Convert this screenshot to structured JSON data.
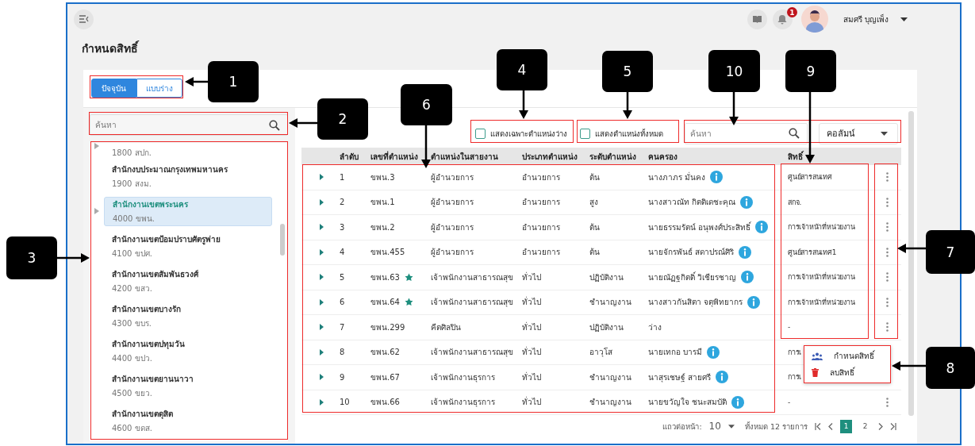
{
  "header": {
    "user_name": "สมศรี บุญเพ็ง",
    "notification_count": "1"
  },
  "page_title": "กำหนดสิทธิ์",
  "version_tabs": [
    {
      "label": "ปัจจุบัน",
      "selected": true
    },
    {
      "label": "แบบร่าง",
      "selected": false
    }
  ],
  "org_search": {
    "placeholder": "ค้นหา"
  },
  "org_list": [
    {
      "code": "1800 สปก.",
      "has_children": true,
      "selected": false
    },
    {
      "name": "สำนักงบประมาณกรุงเทพมหานคร",
      "code": "1900 สงม.",
      "has_children": false,
      "selected": false
    },
    {
      "name": "สำนักงานเขตพระนคร",
      "code": "4000 ขพน.",
      "has_children": true,
      "selected": true
    },
    {
      "name": "สำนักงานเขตป้อมปราบศัตรูพ่าย",
      "code": "4100 ขปศ.",
      "has_children": false,
      "selected": false
    },
    {
      "name": "สำนักงานเขตสัมพันธวงศ์",
      "code": "4200 ขสว.",
      "has_children": false,
      "selected": false
    },
    {
      "name": "สำนักงานเขตบางรัก",
      "code": "4300 ขบร.",
      "has_children": false,
      "selected": false
    },
    {
      "name": "สำนักงานเขตปทุมวัน",
      "code": "4400 ขปว.",
      "has_children": false,
      "selected": false
    },
    {
      "name": "สำนักงานเขตยานนาวา",
      "code": "4500 ขยว.",
      "has_children": false,
      "selected": false
    },
    {
      "name": "สำนักงานเขตดุสิต",
      "code": "4600 ขดส.",
      "has_children": false,
      "selected": false
    }
  ],
  "filters": [
    {
      "label": "แสดงเฉพาะตำแหน่งว่าง",
      "checked": false
    },
    {
      "label": "แสดงตำแหน่งทั้งหมด",
      "checked": false
    }
  ],
  "position_search": {
    "placeholder": "ค้นหา"
  },
  "column_picker": {
    "label": "คอลัมน์"
  },
  "table": {
    "columns": [
      "ลำดับ",
      "เลขที่ตำแหน่ง",
      "ตำแหน่งในสายงาน",
      "ประเภทตำแหน่ง",
      "ระดับตำแหน่ง",
      "คนครอง",
      "สิทธิ์"
    ],
    "rows": [
      {
        "no": "1",
        "position_no": "ขพน.3",
        "starred": false,
        "title": "ผู้อำนวยการ",
        "type": "อำนวยการ",
        "grade": "ต้น",
        "holder": "นางภาภร มั่นคง",
        "holder_info": true,
        "rights": "ศูนย์สารสนเทศ",
        "menu_button": true
      },
      {
        "no": "2",
        "position_no": "ขพน.1",
        "starred": false,
        "title": "ผู้อำนวยการ",
        "type": "อำนวยการ",
        "grade": "สูง",
        "holder": "นางสาวณัท กิตติเดชะคุณ",
        "holder_info": true,
        "rights": "สกจ.",
        "menu_button": true
      },
      {
        "no": "3",
        "position_no": "ขพน.2",
        "starred": false,
        "title": "ผู้อำนวยการ",
        "type": "อำนวยการ",
        "grade": "ต้น",
        "holder": "นายธรรมรัตน์ อนุพงศ์ประสิทธิ์",
        "holder_info": true,
        "rights": "การเจ้าหน้าที่หน่วยงาน",
        "menu_button": true
      },
      {
        "no": "4",
        "position_no": "ขพน.455",
        "starred": false,
        "title": "ผู้อำนวยการ",
        "type": "อำนวยการ",
        "grade": "ต้น",
        "holder": "นายจักรพันธ์ สดาปรณ์ศิริ",
        "holder_info": true,
        "rights": "ศูนย์สารสนเทศ1",
        "menu_button": true
      },
      {
        "no": "5",
        "position_no": "ขพน.63",
        "starred": true,
        "title": "เจ้าพนักงานสาธารณสุข",
        "type": "ทั่วไป",
        "grade": "ปฏิบัติงาน",
        "holder": "นายณัฏฐกิตติ์ วิเชียรชาญ",
        "holder_info": true,
        "rights": "การเจ้าหน้าที่หน่วยงาน",
        "menu_button": true
      },
      {
        "no": "6",
        "position_no": "ขพน.64",
        "starred": true,
        "title": "เจ้าพนักงานสาธารณสุข",
        "type": "ทั่วไป",
        "grade": "ชำนาญงาน",
        "holder": "นางสาวกันสิตา จตุพิทยากร",
        "holder_info": true,
        "rights": "การเจ้าหน้าที่หน่วยงาน",
        "menu_button": true
      },
      {
        "no": "7",
        "position_no": "ขพน.299",
        "starred": false,
        "title": "คีตศิลปิน",
        "type": "ทั่วไป",
        "grade": "ปฏิบัติงาน",
        "holder": "ว่าง",
        "holder_info": false,
        "rights": "-",
        "menu_button": true
      },
      {
        "no": "8",
        "position_no": "ขพน.62",
        "starred": false,
        "title": "เจ้าพนักงานสาธารณสุข",
        "type": "ทั่วไป",
        "grade": "อาวุโส",
        "holder": "นายเทกอ บารมี",
        "holder_info": true,
        "rights": "การเ",
        "menu_button": false
      },
      {
        "no": "9",
        "position_no": "ขพน.67",
        "starred": false,
        "title": "เจ้าพนักงานธุรการ",
        "type": "ทั่วไป",
        "grade": "ชำนาญงาน",
        "holder": "นาสุรเชษฐ์ สายศรี",
        "holder_info": true,
        "rights": "การเ",
        "menu_button": false
      },
      {
        "no": "10",
        "position_no": "ขพน.66",
        "starred": false,
        "title": "เจ้าพนักงานธุรการ",
        "type": "ทั่วไป",
        "grade": "ชำนาญงาน",
        "holder": "นายขวัญใจ ชนะสมบัติ",
        "holder_info": true,
        "rights": "-",
        "menu_button": true
      }
    ]
  },
  "row_menu": {
    "items": [
      {
        "label": "กำหนดสิทธิ์",
        "kind": "assign"
      },
      {
        "label": "ลบสิทธิ์",
        "kind": "delete"
      }
    ]
  },
  "pagination": {
    "rows_label": "แถวต่อหน้า:",
    "rows_per_page": "10",
    "total": "ทั้งหมด 12 รายการ",
    "pages": [
      {
        "label": "1",
        "selected": true
      },
      {
        "label": "2",
        "selected": false
      }
    ]
  },
  "callouts": [
    {
      "label": "4"
    },
    {
      "label": "5"
    },
    {
      "label": "10"
    },
    {
      "label": "9"
    },
    {
      "label": "1"
    },
    {
      "label": "6"
    },
    {
      "label": "2"
    },
    {
      "label": "3"
    },
    {
      "label": "7"
    },
    {
      "label": "8"
    }
  ]
}
